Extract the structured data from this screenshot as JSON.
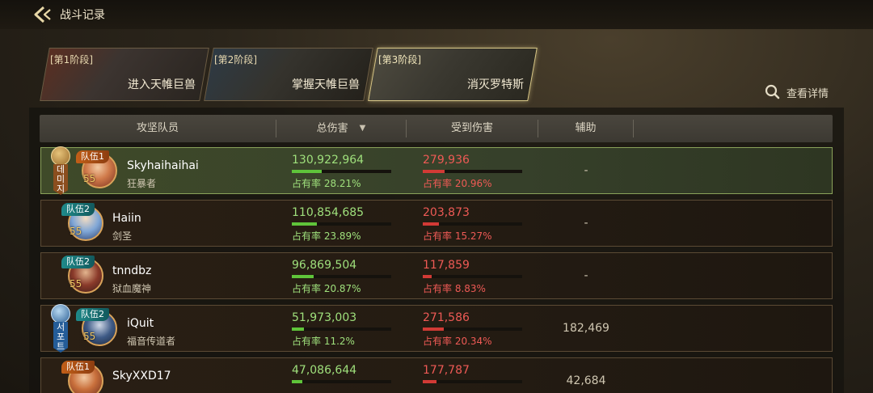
{
  "header": {
    "title": "战斗记录"
  },
  "stages": [
    {
      "num": "[第1阶段]",
      "name": "进入天帷巨兽"
    },
    {
      "num": "[第2阶段]",
      "name": "掌握天帷巨兽"
    },
    {
      "num": "[第3阶段]",
      "name": "消灭罗特斯"
    }
  ],
  "details_link": {
    "label": "查看详情",
    "icon": "search-icon"
  },
  "table": {
    "columns": [
      "攻坚队员",
      "总伤害",
      "受到伤害",
      "辅助"
    ],
    "rows": [
      {
        "role": "데미지",
        "team": "队伍1",
        "level": "55",
        "name": "Skyhaihaihai",
        "class": "狂暴者",
        "damage": "130,922,964",
        "damage_pct": "占有率 28.21%",
        "damage_share": 0.2821,
        "received": "279,936",
        "received_pct": "占有率 20.96%",
        "received_share": 0.2096,
        "assist": "-"
      },
      {
        "role": "",
        "team": "队伍2",
        "level": "55",
        "name": "Haiin",
        "class": "剑圣",
        "damage": "110,854,685",
        "damage_pct": "占有率 23.89%",
        "damage_share": 0.2389,
        "received": "203,873",
        "received_pct": "占有率 15.27%",
        "received_share": 0.1527,
        "assist": "-"
      },
      {
        "role": "",
        "team": "队伍2",
        "level": "55",
        "name": "tnndbz",
        "class": "狱血魔神",
        "damage": "96,869,504",
        "damage_pct": "占有率 20.87%",
        "damage_share": 0.2087,
        "received": "117,859",
        "received_pct": "占有率 8.83%",
        "received_share": 0.0883,
        "assist": "-"
      },
      {
        "role": "서포트",
        "team": "队伍2",
        "level": "55",
        "name": "iQuit",
        "class": "福音传道者",
        "damage": "51,973,003",
        "damage_pct": "占有率 11.2%",
        "damage_share": 0.112,
        "received": "271,586",
        "received_pct": "占有率 20.34%",
        "received_share": 0.2034,
        "assist": "182,469"
      },
      {
        "role": "",
        "team": "队伍1",
        "level": "55",
        "name": "SkyXXD17",
        "class": "",
        "damage": "47,086,644",
        "damage_pct": "",
        "damage_share": 0.101,
        "received": "177,787",
        "received_pct": "",
        "received_share": 0.133,
        "assist": "42,684"
      }
    ]
  },
  "colors": {
    "damage": "#9fe07c",
    "received": "#ee5a55",
    "highlight": "#8aa25a"
  }
}
